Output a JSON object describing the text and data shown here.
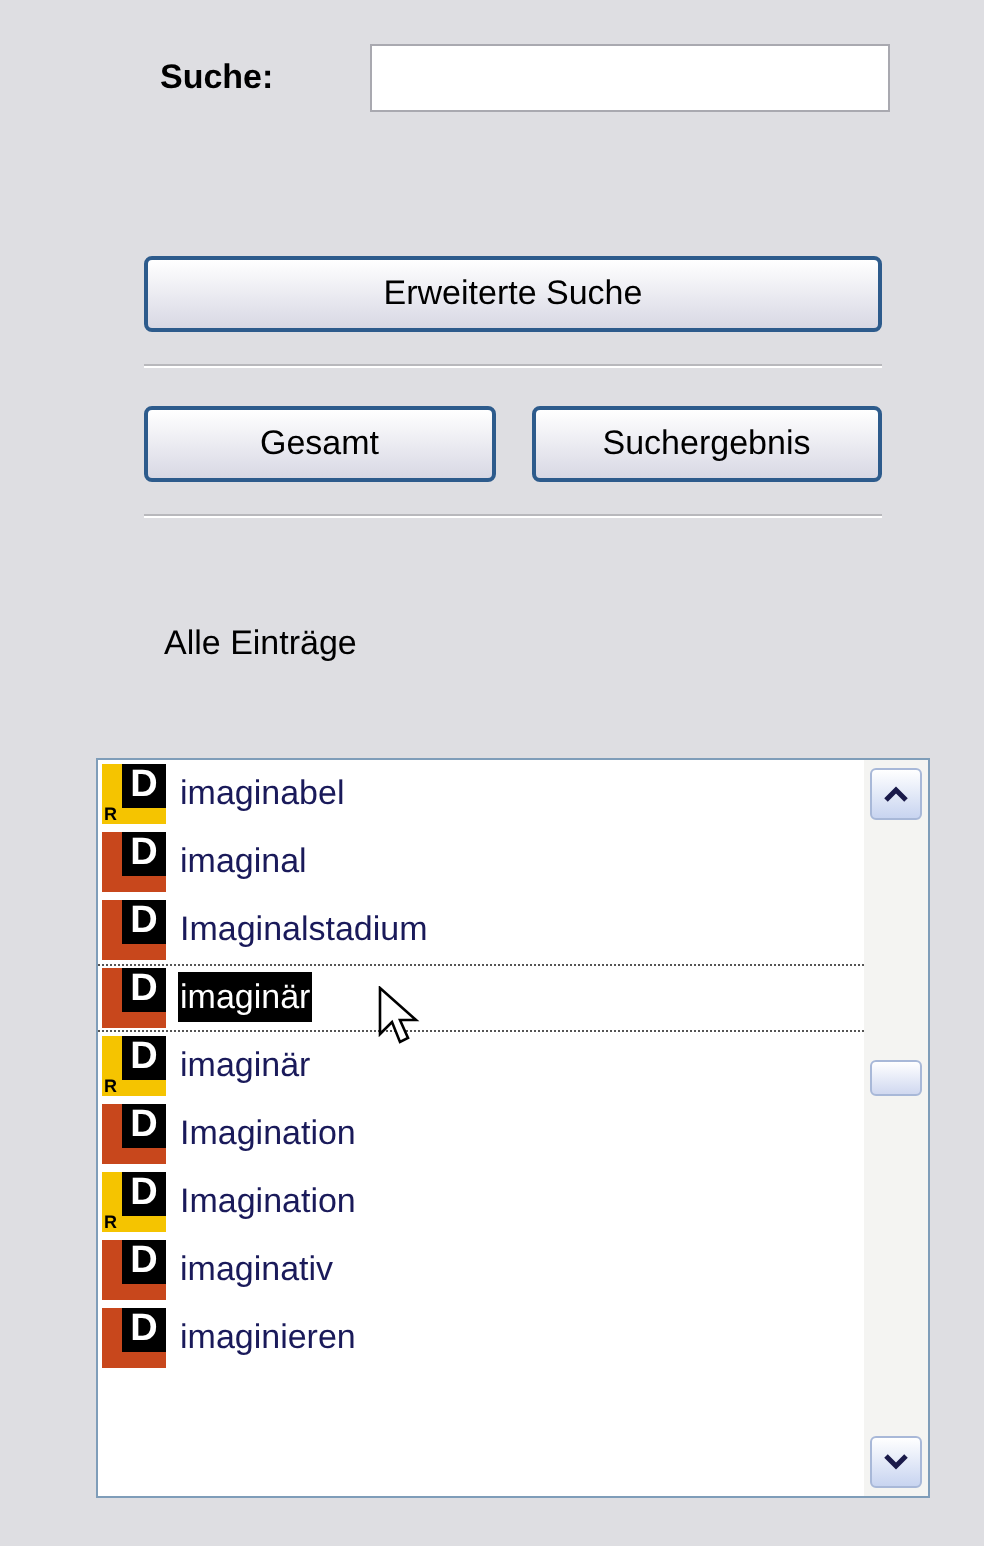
{
  "search": {
    "label": "Suche:"
  },
  "buttons": {
    "advanced": "Erweiterte Suche",
    "all": "Gesamt",
    "results": "Suchergebnis"
  },
  "list_title": "Alle Einträge",
  "entries": [
    {
      "text": "imaginabel",
      "kind": "dr",
      "badge": "D",
      "sub": "R",
      "selected": false
    },
    {
      "text": "imaginal",
      "kind": "d",
      "badge": "D",
      "selected": false
    },
    {
      "text": "Imaginalstadium",
      "kind": "d",
      "badge": "D",
      "selected": false
    },
    {
      "text": "imaginär",
      "kind": "d",
      "badge": "D",
      "selected": true
    },
    {
      "text": "imaginär",
      "kind": "dr",
      "badge": "D",
      "sub": "R",
      "selected": false
    },
    {
      "text": "Imagination",
      "kind": "d",
      "badge": "D",
      "selected": false
    },
    {
      "text": "Imagination",
      "kind": "dr",
      "badge": "D",
      "sub": "R",
      "selected": false
    },
    {
      "text": "imaginativ",
      "kind": "d",
      "badge": "D",
      "selected": false
    },
    {
      "text": "imaginieren",
      "kind": "d",
      "badge": "D",
      "selected": false
    }
  ]
}
